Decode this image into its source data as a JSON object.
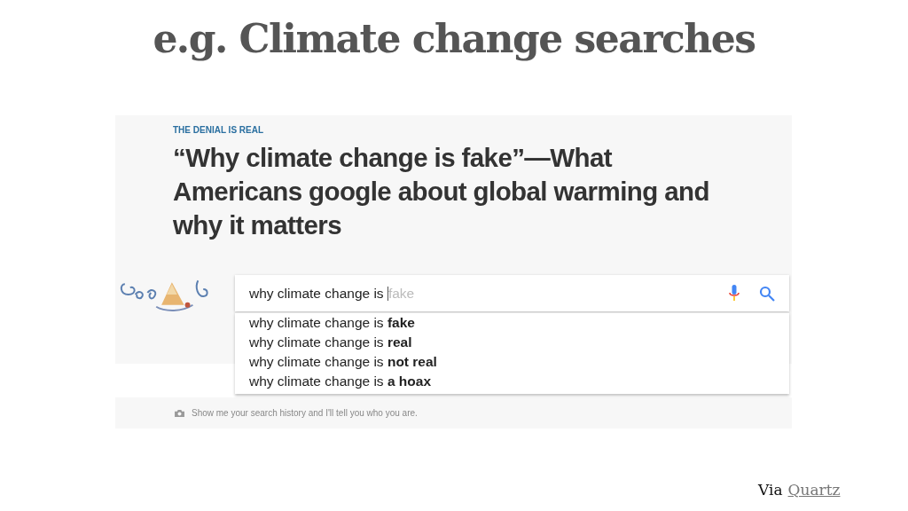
{
  "slide": {
    "title": "e.g. Climate change searches"
  },
  "article": {
    "kicker": "THE DENIAL IS REAL",
    "headline": "“Why climate change is fake”—What Americans google about global warming and why it matters"
  },
  "search": {
    "value": "why climate change is ",
    "completion": "fake",
    "suggestions": [
      {
        "text": "why climate change is **fake**"
      },
      {
        "text": "why climate change is **real**"
      },
      {
        "text": "why climate change is **not real**"
      },
      {
        "text": "why climate change is **a hoax**"
      }
    ]
  },
  "caption": "Show me your search history and I'll tell you who you are.",
  "source": {
    "label": "Via",
    "link": "Quartz"
  }
}
